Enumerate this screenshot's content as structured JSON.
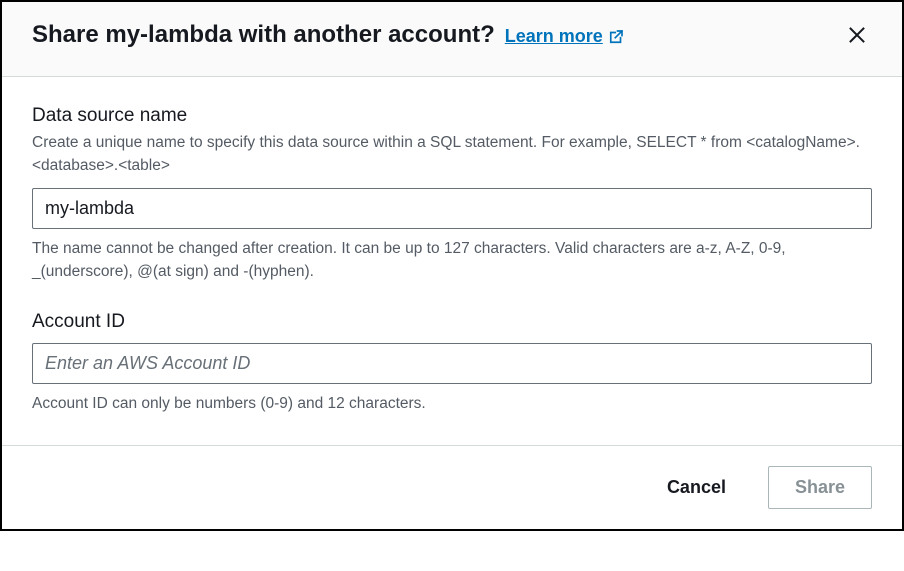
{
  "header": {
    "title": "Share my-lambda with another account?",
    "learn_more_label": "Learn more"
  },
  "fields": {
    "data_source_name": {
      "label": "Data source name",
      "description": "Create a unique name to specify this data source within a SQL statement. For example, SELECT * from <catalogName>.<database>.<table>",
      "value": "my-lambda",
      "hint": "The name cannot be changed after creation. It can be up to 127 characters. Valid characters are a-z, A-Z, 0-9, _(underscore), @(at sign) and -(hyphen)."
    },
    "account_id": {
      "label": "Account ID",
      "placeholder": "Enter an AWS Account ID",
      "value": "",
      "hint": "Account ID can only be numbers (0-9) and 12 characters."
    }
  },
  "footer": {
    "cancel_label": "Cancel",
    "share_label": "Share"
  }
}
